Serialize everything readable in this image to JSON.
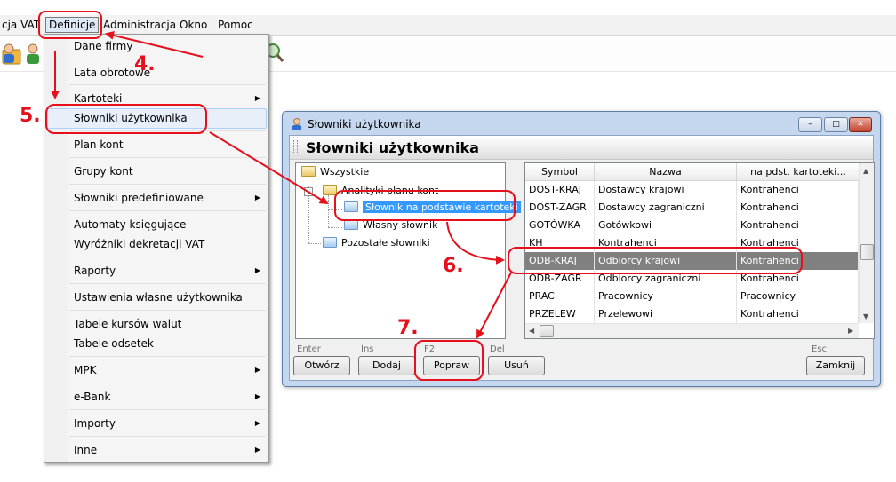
{
  "menubar": {
    "items": [
      "cja VAT",
      "Definicje",
      "Administracja",
      "Okno",
      "Pomoc"
    ]
  },
  "menu": {
    "items": [
      {
        "label": "Dane firmy",
        "submenu": false
      },
      {
        "label": "Lata obrotowe",
        "submenu": false
      },
      {
        "label": "Kartoteki",
        "submenu": true
      },
      {
        "label": "Słowniki użytkownika",
        "submenu": false
      },
      {
        "label": "Plan kont",
        "submenu": false
      },
      {
        "label": "Grupy kont",
        "submenu": false
      },
      {
        "label": "Słowniki predefiniowane",
        "submenu": true
      },
      {
        "label": "Automaty księgujące",
        "submenu": false
      },
      {
        "label": "Wyróżniki dekretacji VAT",
        "submenu": false
      },
      {
        "label": "Raporty",
        "submenu": true
      },
      {
        "label": "Ustawienia własne użytkownika",
        "submenu": false
      },
      {
        "label": "Tabele kursów walut",
        "submenu": false
      },
      {
        "label": "Tabele odsetek",
        "submenu": false
      },
      {
        "label": "MPK",
        "submenu": true
      },
      {
        "label": "e-Bank",
        "submenu": true
      },
      {
        "label": "Importy",
        "submenu": true
      },
      {
        "label": "Inne",
        "submenu": true
      }
    ],
    "arrow_glyph": "▶"
  },
  "window": {
    "title": "Słowniki użytkownika",
    "header": "Słowniki użytkownika",
    "controls": {
      "minimize": "–",
      "maximize": "□",
      "close": "✕"
    }
  },
  "tree": {
    "root": "Wszystkie",
    "group": "Analityki planu kont",
    "selected": "Słownik na podstawie kartoteki",
    "own": "Własny słownik",
    "others": "Pozostałe słowniki",
    "expander": "–"
  },
  "grid": {
    "columns": [
      "Symbol",
      "Nazwa",
      "na pdst. kartoteki..."
    ],
    "rows": [
      {
        "symbol": "DOST-KRAJ",
        "nazwa": "Dostawcy krajowi",
        "kartoteka": "Kontrahenci",
        "selected": false
      },
      {
        "symbol": "DOST-ZAGR",
        "nazwa": "Dostawcy zagraniczni",
        "kartoteka": "Kontrahenci",
        "selected": false
      },
      {
        "symbol": "GOTÓWKA",
        "nazwa": "Gotówkowi",
        "kartoteka": "Kontrahenci",
        "selected": false
      },
      {
        "symbol": "KH",
        "nazwa": "Kontrahenci",
        "kartoteka": "Kontrahenci",
        "selected": false
      },
      {
        "symbol": "ODB-KRAJ",
        "nazwa": "Odbiorcy krajowi",
        "kartoteka": "Kontrahenci",
        "selected": true
      },
      {
        "symbol": "ODB-ZAGR",
        "nazwa": "Odbiorcy zagraniczni",
        "kartoteka": "Kontrahenci",
        "selected": false
      },
      {
        "symbol": "PRAC",
        "nazwa": "Pracownicy",
        "kartoteka": "Pracownicy",
        "selected": false
      },
      {
        "symbol": "PRZELEW",
        "nazwa": "Przelewowi",
        "kartoteka": "Kontrahenci",
        "selected": false
      }
    ],
    "scroll_arrows": {
      "up": "▲",
      "down": "▼",
      "left": "◀",
      "right": "▶"
    }
  },
  "buttons": {
    "open": {
      "label": "Otwórz",
      "hint": "Enter"
    },
    "add": {
      "label": "Dodaj",
      "hint": "Ins"
    },
    "edit": {
      "label": "Popraw",
      "hint": "F2"
    },
    "delete": {
      "label": "Usuń",
      "hint": "Del"
    },
    "close": {
      "label": "Zamknij",
      "hint": "Esc"
    }
  },
  "annotations": {
    "steps": [
      "4.",
      "5.",
      "6.",
      "7."
    ],
    "color": "#e5101b"
  }
}
